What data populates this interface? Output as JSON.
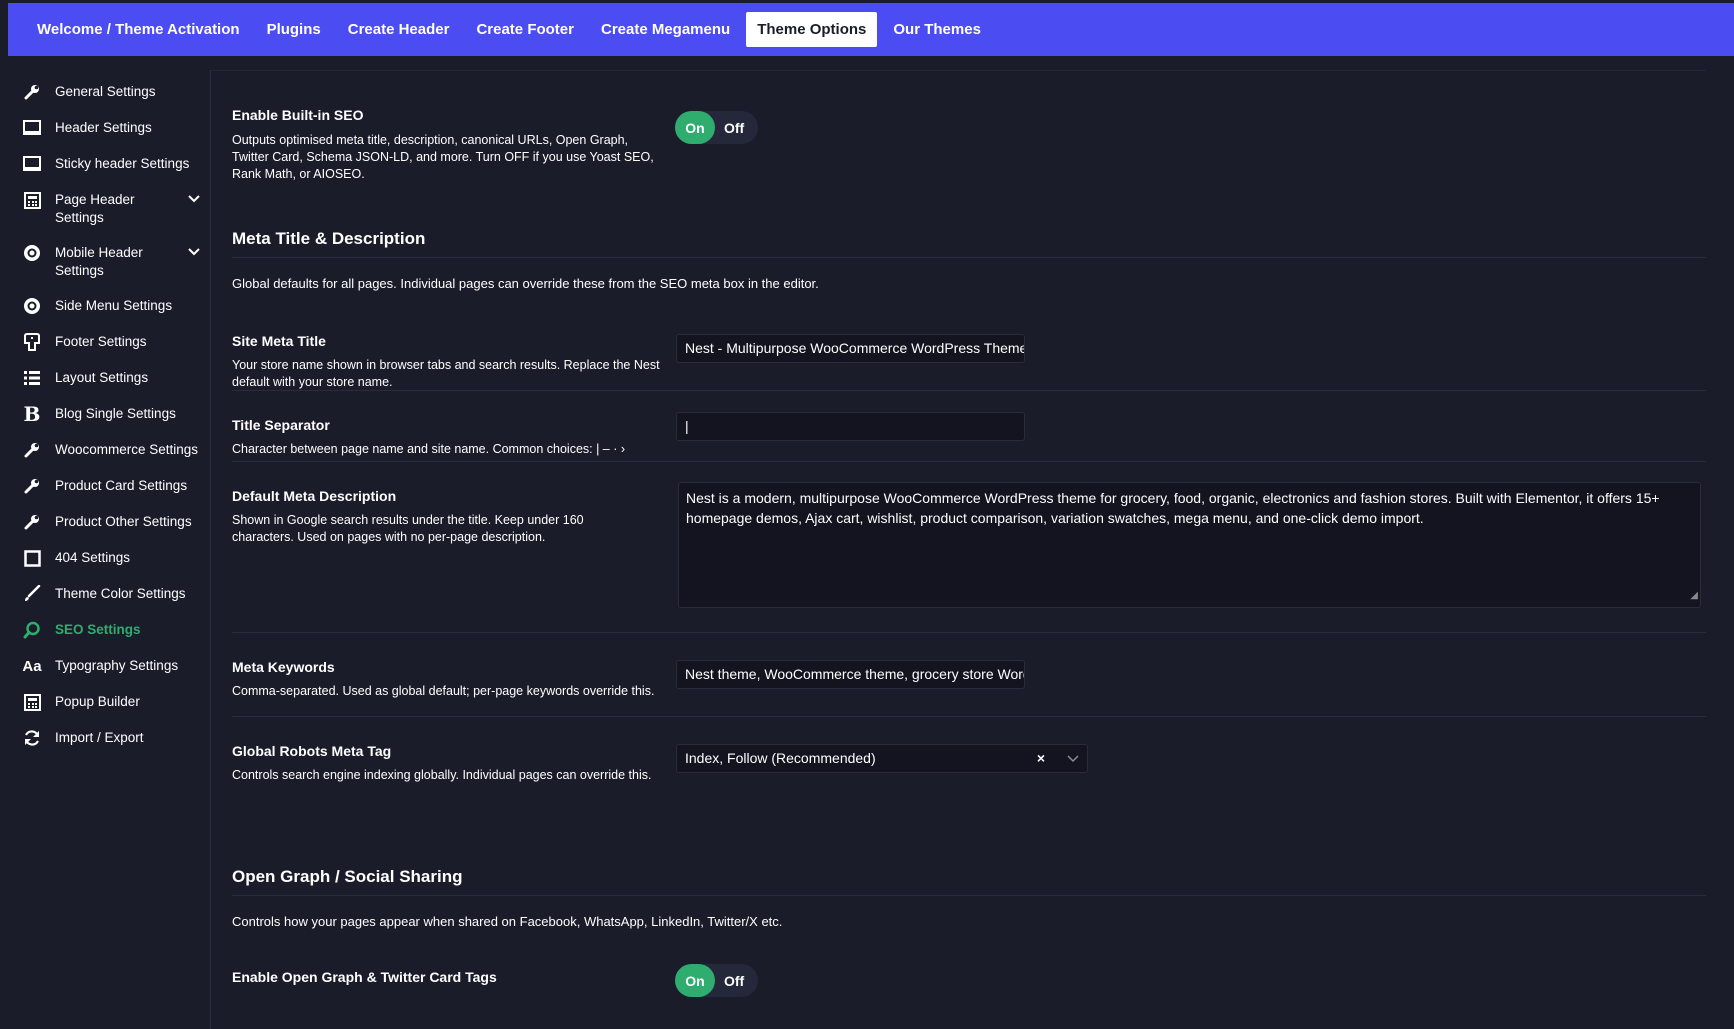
{
  "topnav": {
    "tabs": [
      {
        "label": "Welcome / Theme Activation",
        "active": false
      },
      {
        "label": "Plugins",
        "active": false
      },
      {
        "label": "Create Header",
        "active": false
      },
      {
        "label": "Create Footer",
        "active": false
      },
      {
        "label": "Create Megamenu",
        "active": false
      },
      {
        "label": "Theme Options",
        "active": true
      },
      {
        "label": "Our Themes",
        "active": false
      }
    ]
  },
  "sidebar": {
    "items": [
      {
        "label": "General Settings",
        "icon": "wrench-icon"
      },
      {
        "label": "Header Settings",
        "icon": "window-icon"
      },
      {
        "label": "Sticky header Settings",
        "icon": "window-icon"
      },
      {
        "label": "Page Header Settings",
        "icon": "calculator-icon",
        "expandable": true
      },
      {
        "label": "Mobile Header Settings",
        "icon": "circle-dot-icon",
        "expandable": true
      },
      {
        "label": "Side Menu Settings",
        "icon": "circle-dot-icon"
      },
      {
        "label": "Footer Settings",
        "icon": "footer-icon"
      },
      {
        "label": "Layout Settings",
        "icon": "list-icon"
      },
      {
        "label": "Blog Single Settings",
        "icon": "bold-b-icon"
      },
      {
        "label": "Woocommerce Settings",
        "icon": "wrench-icon"
      },
      {
        "label": "Product Card Settings",
        "icon": "wrench-icon"
      },
      {
        "label": "Product Other Settings",
        "icon": "wrench-icon"
      },
      {
        "label": "404 Settings",
        "icon": "square-icon"
      },
      {
        "label": "Theme Color Settings",
        "icon": "brush-icon"
      },
      {
        "label": "SEO Settings",
        "icon": "search-icon",
        "active": true
      },
      {
        "label": "Typography Settings",
        "icon": "font-aa-icon"
      },
      {
        "label": "Popup Builder",
        "icon": "calculator-icon"
      },
      {
        "label": "Import / Export",
        "icon": "refresh-icon"
      }
    ],
    "active_color": "#2ead6f"
  },
  "seo": {
    "builtin": {
      "label": "Enable Built-in SEO",
      "desc": "Outputs optimised meta title, description, canonical URLs, Open Graph, Twitter Card, Schema JSON-LD, and more. Turn OFF if you use Yoast SEO, Rank Math, or AIOSEO.",
      "on_label": "On",
      "off_label": "Off",
      "value": "On"
    },
    "meta_section": {
      "title": "Meta Title & Description",
      "desc": "Global defaults for all pages. Individual pages can override these from the SEO meta box in the editor."
    },
    "site_meta_title": {
      "label": "Site Meta Title",
      "desc": "Your store name shown in browser tabs and search results. Replace the Nest default with your store name.",
      "value": "Nest - Multipurpose WooCommerce WordPress Theme"
    },
    "title_separator": {
      "label": "Title Separator",
      "desc": "Character between page name and site name. Common choices: | – · ›",
      "value": "|"
    },
    "default_meta_description": {
      "label": "Default Meta Description",
      "desc": "Shown in Google search results under the title. Keep under 160 characters. Used on pages with no per-page description.",
      "value": "Nest is a modern, multipurpose WooCommerce WordPress theme for grocery, food, organic, electronics and fashion stores. Built with Elementor, it offers 15+ homepage demos, Ajax cart, wishlist, product comparison, variation swatches, mega menu, and one-click demo import."
    },
    "meta_keywords": {
      "label": "Meta Keywords",
      "desc": "Comma-separated. Used as global default; per-page keywords override this.",
      "value": "Nest theme, WooCommerce theme, grocery store WordPress"
    },
    "robots": {
      "label": "Global Robots Meta Tag",
      "desc": "Controls search engine indexing globally. Individual pages can override this.",
      "value": "Index, Follow (Recommended)",
      "clear_glyph": "×",
      "chevron_glyph": "⌵"
    },
    "og_section": {
      "title": "Open Graph / Social Sharing",
      "desc": "Controls how your pages appear when shared on Facebook, WhatsApp, LinkedIn, Twitter/X etc."
    },
    "og_enable": {
      "label": "Enable Open Graph & Twitter Card Tags",
      "on_label": "On",
      "off_label": "Off",
      "value": "On"
    }
  }
}
